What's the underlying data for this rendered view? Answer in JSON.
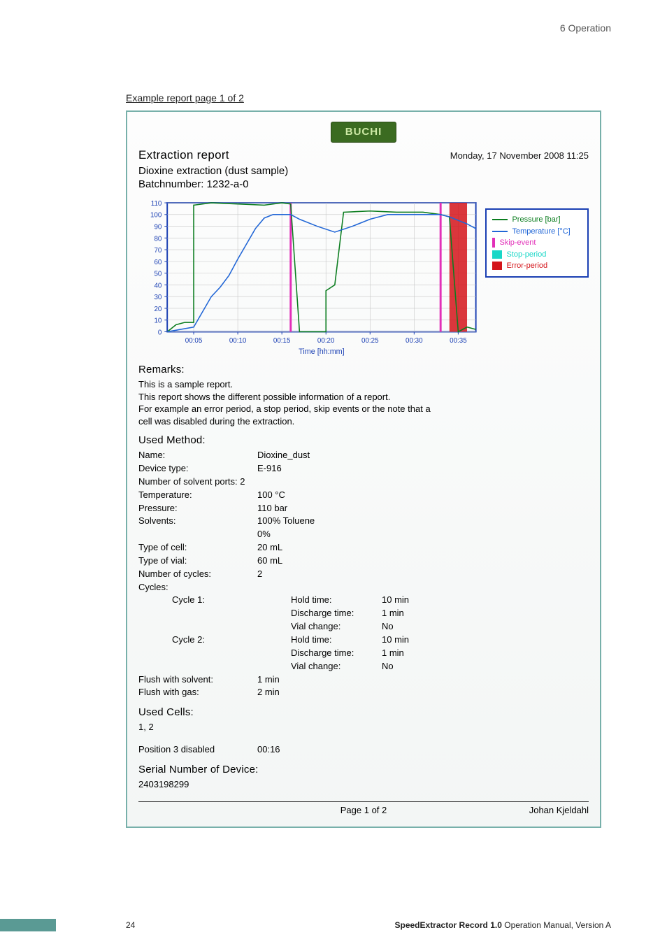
{
  "header_right": "6   Operation",
  "caption": "Example report page 1 of 2",
  "logo_text": "BUCHI",
  "report": {
    "title": "Extraction report",
    "subtitle": "Dioxine extraction (dust sample)",
    "batch": "Batchnumber: 1232-a-0",
    "datetime": "Monday, 17 November 2008 11:25",
    "axis_x_label": "Time [hh:mm]"
  },
  "legend": {
    "pressure": "Pressure [bar]",
    "temperature": "Temperature [°C]",
    "skip": "Skip-event",
    "stop": "Stop-period",
    "error": "Error-period"
  },
  "chart_data": {
    "type": "line",
    "xlabel": "Time [hh:mm]",
    "ylabel": "",
    "ylim": [
      0,
      110
    ],
    "x_ticks": [
      "00:05",
      "00:10",
      "00:15",
      "00:20",
      "00:25",
      "00:30",
      "00:35"
    ],
    "y_ticks": [
      0,
      10,
      20,
      30,
      40,
      50,
      60,
      70,
      80,
      90,
      100,
      110
    ],
    "series": [
      {
        "name": "Pressure [bar]",
        "color": "#0b7d1f",
        "points": [
          [
            "00:02",
            0
          ],
          [
            "00:03",
            6
          ],
          [
            "00:04",
            8
          ],
          [
            "00:05",
            8
          ],
          [
            "00:05",
            108
          ],
          [
            "00:07",
            110
          ],
          [
            "00:10",
            109
          ],
          [
            "00:13",
            108
          ],
          [
            "00:15",
            110
          ],
          [
            "00:16",
            109
          ],
          [
            "00:17",
            0
          ],
          [
            "00:20",
            0
          ],
          [
            "00:20",
            35
          ],
          [
            "00:21",
            40
          ],
          [
            "00:22",
            102
          ],
          [
            "00:25",
            103
          ],
          [
            "00:28",
            102
          ],
          [
            "00:31",
            102
          ],
          [
            "00:33",
            100
          ],
          [
            "00:34",
            98
          ],
          [
            "00:35",
            0
          ],
          [
            "00:36",
            4
          ],
          [
            "00:37",
            2
          ]
        ]
      },
      {
        "name": "Temperature [°C]",
        "color": "#2166d6",
        "points": [
          [
            "00:02",
            0
          ],
          [
            "00:05",
            4
          ],
          [
            "00:07",
            30
          ],
          [
            "00:08",
            38
          ],
          [
            "00:09",
            48
          ],
          [
            "00:10",
            62
          ],
          [
            "00:11",
            75
          ],
          [
            "00:12",
            88
          ],
          [
            "00:13",
            97
          ],
          [
            "00:14",
            100
          ],
          [
            "00:16",
            100
          ],
          [
            "00:17",
            96
          ],
          [
            "00:19",
            90
          ],
          [
            "00:21",
            85
          ],
          [
            "00:23",
            90
          ],
          [
            "00:25",
            96
          ],
          [
            "00:27",
            100
          ],
          [
            "00:30",
            100
          ],
          [
            "00:33",
            100
          ],
          [
            "00:34",
            98
          ],
          [
            "00:36",
            92
          ],
          [
            "00:37",
            88
          ]
        ]
      }
    ],
    "skip_events_x": [
      "00:16",
      "00:33"
    ],
    "stop_period": null,
    "error_period": [
      "00:34",
      "00:36"
    ]
  },
  "remarks": {
    "heading": "Remarks:",
    "lines": [
      "This is a sample report.",
      "This report shows the different possible information of a report.",
      "For example an error period, a stop period, skip events or the note that a",
      "cell was disabled during the extraction."
    ]
  },
  "method": {
    "heading": "Used Method:",
    "rows": [
      {
        "label": "Name:",
        "value": "Dioxine_dust"
      },
      {
        "label": "Device type:",
        "value": "E-916"
      },
      {
        "label": "Number of solvent ports:",
        "value": "2"
      },
      {
        "label": "Temperature:",
        "value": "100 °C"
      },
      {
        "label": "Pressure:",
        "value": "110 bar"
      },
      {
        "label": "Solvents:",
        "value": "100% Toluene"
      },
      {
        "label": "",
        "value": "0%"
      },
      {
        "label": "Type of cell:",
        "value": "20 mL"
      },
      {
        "label": "Type of vial:",
        "value": "60 mL"
      },
      {
        "label": "Number of cycles:",
        "value": "2"
      },
      {
        "label": "Cycles:",
        "value": ""
      }
    ],
    "cycles": [
      {
        "name": "Cycle 1:",
        "lines": [
          {
            "k": "Hold time:",
            "v": "10 min"
          },
          {
            "k": "Discharge time:",
            "v": "1 min"
          },
          {
            "k": "Vial change:",
            "v": "No"
          }
        ]
      },
      {
        "name": "Cycle 2:",
        "lines": [
          {
            "k": "Hold time:",
            "v": "10 min"
          },
          {
            "k": "Discharge time:",
            "v": "1 min"
          },
          {
            "k": "Vial change:",
            "v": "No"
          }
        ]
      }
    ],
    "tail": [
      {
        "label": "Flush with solvent:",
        "value": "1 min"
      },
      {
        "label": "Flush with gas:",
        "value": "2 min"
      }
    ]
  },
  "used_cells": {
    "heading": "Used Cells:",
    "value": "1, 2",
    "disabled_label": "Position 3 disabled",
    "disabled_time": "00:16"
  },
  "serial": {
    "heading": "Serial Number of Device:",
    "value": "2403198299"
  },
  "footer": {
    "page": "Page 1 of 2",
    "author": "Johan Kjeldahl"
  },
  "page_bottom": {
    "left": "24",
    "right_bold": "SpeedExtractor Record 1.0",
    "right_rest": " Operation Manual, Version A"
  }
}
